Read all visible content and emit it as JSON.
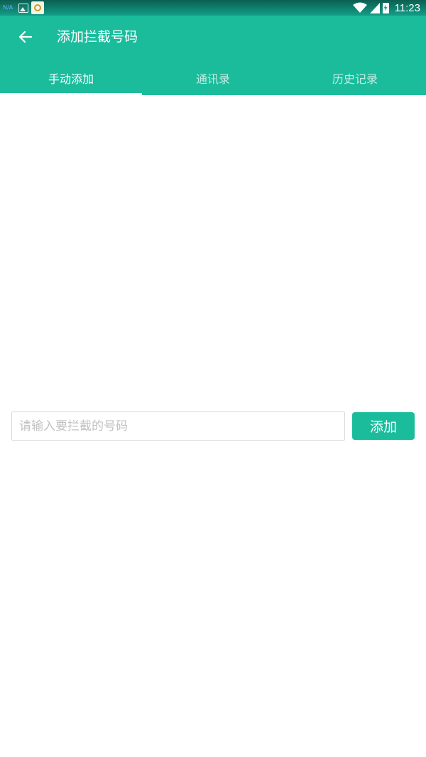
{
  "status_bar": {
    "time": "11:23",
    "nfc_label": "N/A",
    "icons": [
      "image-notification-icon",
      "app-notification-icon",
      "wifi-icon",
      "signal-icon",
      "battery-charging-icon"
    ]
  },
  "app_bar": {
    "back_icon": "arrow-left-icon",
    "title": "添加拦截号码"
  },
  "tabs": [
    {
      "label": "手动添加",
      "active": true
    },
    {
      "label": "通讯录",
      "active": false
    },
    {
      "label": "历史记录",
      "active": false
    }
  ],
  "form": {
    "placeholder": "请输入要拦截的号码",
    "value": "",
    "add_label": "添加"
  },
  "colors": {
    "primary": "#1abc9c",
    "status_bar": "#129e87"
  }
}
